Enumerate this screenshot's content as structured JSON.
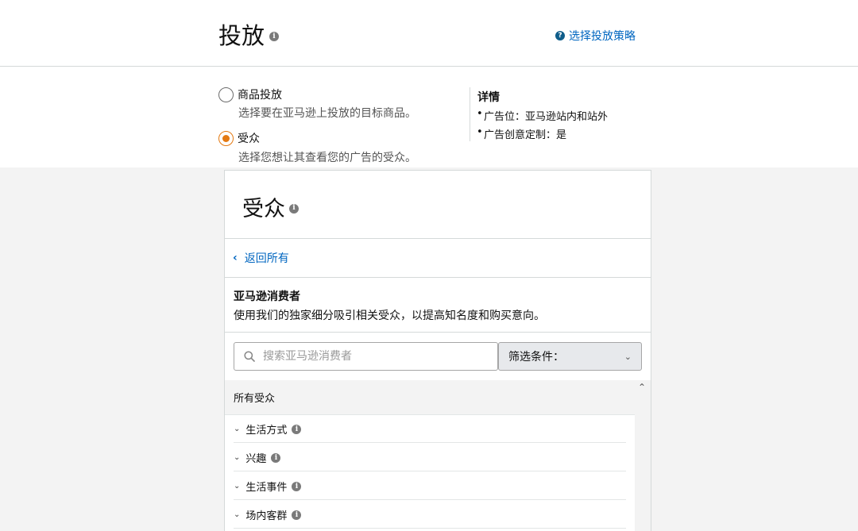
{
  "header": {
    "title": "投放",
    "strategy_link": "选择投放策略"
  },
  "targeting_options": [
    {
      "label": "商品投放",
      "description": "选择要在亚马逊上投放的目标商品。",
      "selected": false
    },
    {
      "label": "受众",
      "description": "选择您想让其查看您的广告的受众。",
      "selected": true
    }
  ],
  "details": {
    "title": "详情",
    "items": [
      "广告位：亚马逊站内和站外",
      "广告创意定制：是"
    ]
  },
  "audience_panel": {
    "title": "受众",
    "back_label": "返回所有",
    "section_title": "亚马逊消费者",
    "section_description": "使用我们的独家细分吸引相关受众，以提高知名度和购买意向。",
    "search_placeholder": "搜索亚马逊消费者",
    "filter_label": "筛选条件：",
    "list_header": "所有受众",
    "categories": [
      "生活方式",
      "兴趣",
      "生活事件",
      "场内客群"
    ]
  },
  "colors": {
    "link": "#0066c0",
    "radio_selected": "#e47911"
  },
  "icons": {
    "info": "info-icon",
    "help": "question-icon",
    "search": "search-icon",
    "back": "chevron-left-icon",
    "expand": "chevron-down-icon",
    "scroll_up": "chevron-up-icon"
  }
}
